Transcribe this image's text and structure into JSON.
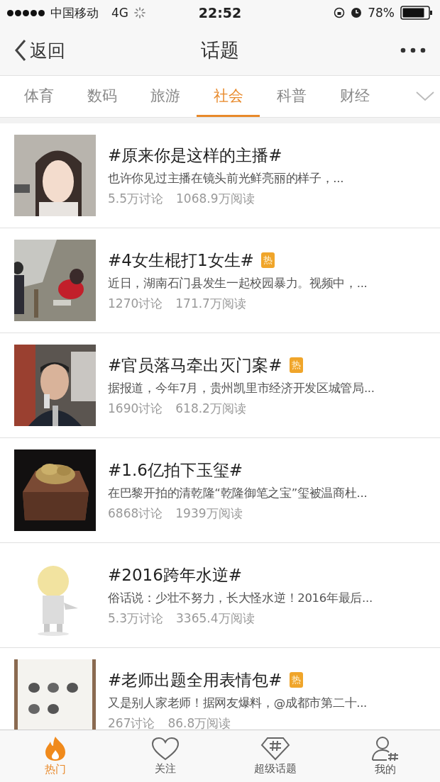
{
  "status_bar": {
    "carrier": "中国移动",
    "network": "4G",
    "time": "22:52",
    "battery": "78%"
  },
  "nav": {
    "back": "返回",
    "title": "话题"
  },
  "tabs": [
    {
      "label": "体育",
      "selected": false
    },
    {
      "label": "数码",
      "selected": false
    },
    {
      "label": "旅游",
      "selected": false
    },
    {
      "label": "社会",
      "selected": true
    },
    {
      "label": "科普",
      "selected": false
    },
    {
      "label": "财经",
      "selected": false
    }
  ],
  "topics": [
    {
      "title": "#原来你是这样的主播#",
      "summary": "也许你见过主播在镜头前光鲜亮丽的样子，...",
      "discussions": "5.5万讨论",
      "reads": "1068.9万阅读"
    },
    {
      "title": "#4女生棍打1女生#",
      "badge": "热",
      "summary": "近日，湖南石门县发生一起校园暴力。视频中，...",
      "discussions": "1270讨论",
      "reads": "171.7万阅读"
    },
    {
      "title": "#官员落马牵出灭门案#",
      "badge": "热",
      "summary": "据报道，今年7月，贵州凯里市经济开发区城管局...",
      "discussions": "1690讨论",
      "reads": "618.2万阅读"
    },
    {
      "title": "#1.6亿拍下玉玺#",
      "summary": "在巴黎开拍的清乾隆“乾隆御笔之宝”玺被温商杜...",
      "discussions": "6868讨论",
      "reads": "1939万阅读"
    },
    {
      "title": "#2016跨年水逆#",
      "summary": "俗话说：少壮不努力，长大怪水逆！2016年最后...",
      "discussions": "5.3万讨论",
      "reads": "3365.4万阅读"
    },
    {
      "title": "#老师出题全用表情包#",
      "badge": "热",
      "summary": "又是别人家老师！据网友爆料，@成都市第二十...",
      "discussions": "267讨论",
      "reads": "86.8万阅读"
    }
  ],
  "bottom_tabs": [
    {
      "kind": "flame",
      "label": "热门",
      "selected": true
    },
    {
      "kind": "heart",
      "label": "关注",
      "selected": false
    },
    {
      "kind": "hashtag",
      "label": "超级话题",
      "selected": false
    },
    {
      "kind": "profile",
      "label": "我的",
      "selected": false
    }
  ]
}
